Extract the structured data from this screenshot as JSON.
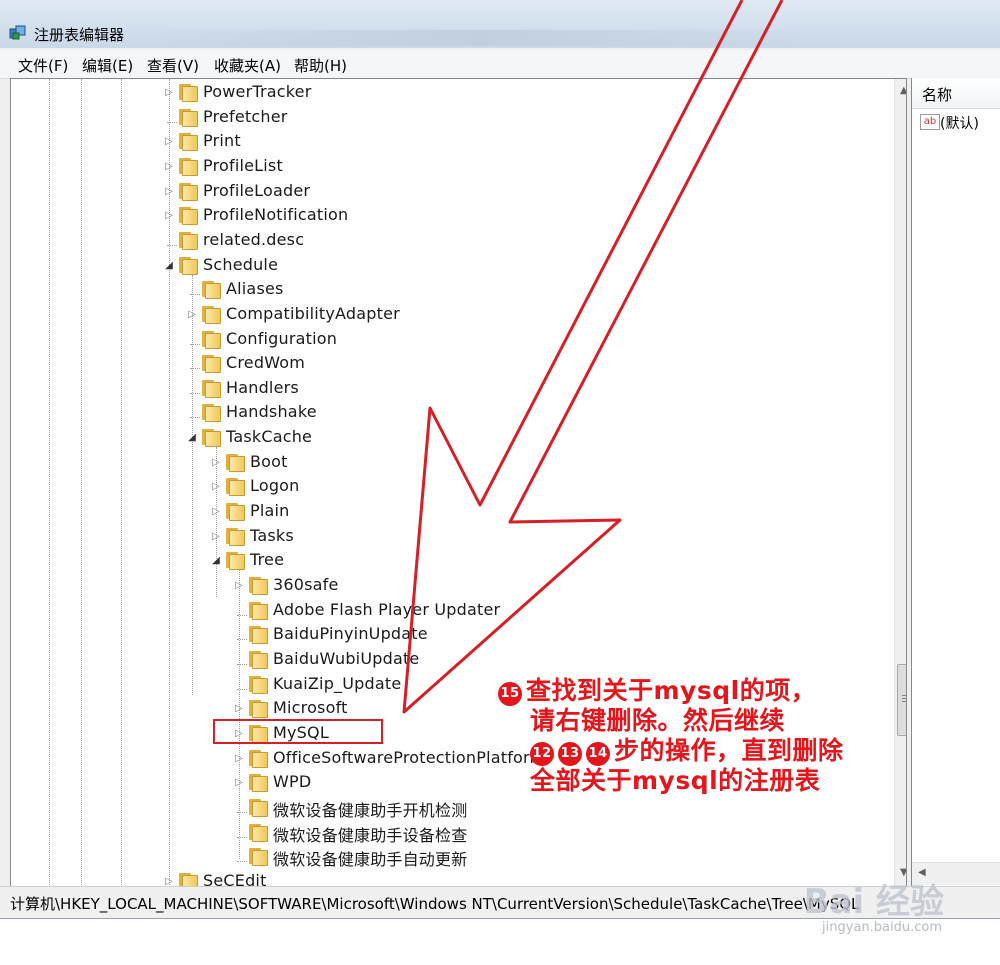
{
  "window": {
    "title": "注册表编辑器"
  },
  "menu": [
    "文件(F)",
    "编辑(E)",
    "查看(V)",
    "收藏夹(A)",
    "帮助(H)"
  ],
  "tree": [
    {
      "label": "PowerTracker",
      "expander": "closed",
      "depth": 0
    },
    {
      "label": "Prefetcher",
      "expander": "none",
      "depth": 0
    },
    {
      "label": "Print",
      "expander": "closed",
      "depth": 0
    },
    {
      "label": "ProfileList",
      "expander": "closed",
      "depth": 0
    },
    {
      "label": "ProfileLoader",
      "expander": "closed",
      "depth": 0
    },
    {
      "label": "ProfileNotification",
      "expander": "closed",
      "depth": 0
    },
    {
      "label": "related.desc",
      "expander": "none",
      "depth": 0
    },
    {
      "label": "Schedule",
      "expander": "open",
      "depth": 0
    },
    {
      "label": "Aliases",
      "expander": "none",
      "depth": 1
    },
    {
      "label": "CompatibilityAdapter",
      "expander": "closed",
      "depth": 1
    },
    {
      "label": "Configuration",
      "expander": "none",
      "depth": 1
    },
    {
      "label": "CredWom",
      "expander": "none",
      "depth": 1
    },
    {
      "label": "Handlers",
      "expander": "none",
      "depth": 1
    },
    {
      "label": "Handshake",
      "expander": "none",
      "depth": 1
    },
    {
      "label": "TaskCache",
      "expander": "open",
      "depth": 1
    },
    {
      "label": "Boot",
      "expander": "closed",
      "depth": 2
    },
    {
      "label": "Logon",
      "expander": "closed",
      "depth": 2
    },
    {
      "label": "Plain",
      "expander": "closed",
      "depth": 2
    },
    {
      "label": "Tasks",
      "expander": "closed",
      "depth": 2
    },
    {
      "label": "Tree",
      "expander": "open",
      "depth": 2
    },
    {
      "label": "360safe",
      "expander": "closed",
      "depth": 3
    },
    {
      "label": "Adobe Flash Player Updater",
      "expander": "none",
      "depth": 3
    },
    {
      "label": "BaiduPinyinUpdate",
      "expander": "none",
      "depth": 3
    },
    {
      "label": "BaiduWubiUpdate",
      "expander": "none",
      "depth": 3
    },
    {
      "label": "KuaiZip_Update",
      "expander": "none",
      "depth": 3
    },
    {
      "label": "Microsoft",
      "expander": "closed",
      "depth": 3
    },
    {
      "label": "MySQL",
      "expander": "closed",
      "depth": 3
    },
    {
      "label": "OfficeSoftwareProtectionPlatform",
      "expander": "closed",
      "depth": 3
    },
    {
      "label": "WPD",
      "expander": "closed",
      "depth": 3
    },
    {
      "label": "微软设备健康助手开机检测",
      "expander": "none",
      "depth": 3
    },
    {
      "label": "微软设备健康助手设备检查",
      "expander": "none",
      "depth": 3
    },
    {
      "label": "微软设备健康助手自动更新",
      "expander": "none",
      "depth": 3
    },
    {
      "label": "SeCEdit",
      "expander": "closed",
      "depth": 0
    }
  ],
  "values": {
    "column_name": "名称",
    "default_value_name": "(默认)",
    "icon": "string-value-ab-icon"
  },
  "statusbar": {
    "path": "计算机\\HKEY_LOCAL_MACHINE\\SOFTWARE\\Microsoft\\Windows NT\\CurrentVersion\\Schedule\\TaskCache\\Tree\\MySQL"
  },
  "annotation": {
    "step_badge": "15",
    "line1": "查找到关于mysql的项，",
    "line2": "请右键删除。然后继续",
    "badges": [
      "12",
      "13",
      "14"
    ],
    "line3_rest": "步的操作，直到删除",
    "line4": "全部关于mysql的注册表",
    "color": "#e4161b"
  },
  "watermark": {
    "main": "Bai 经验",
    "sub": "jingyan.baidu.com"
  }
}
